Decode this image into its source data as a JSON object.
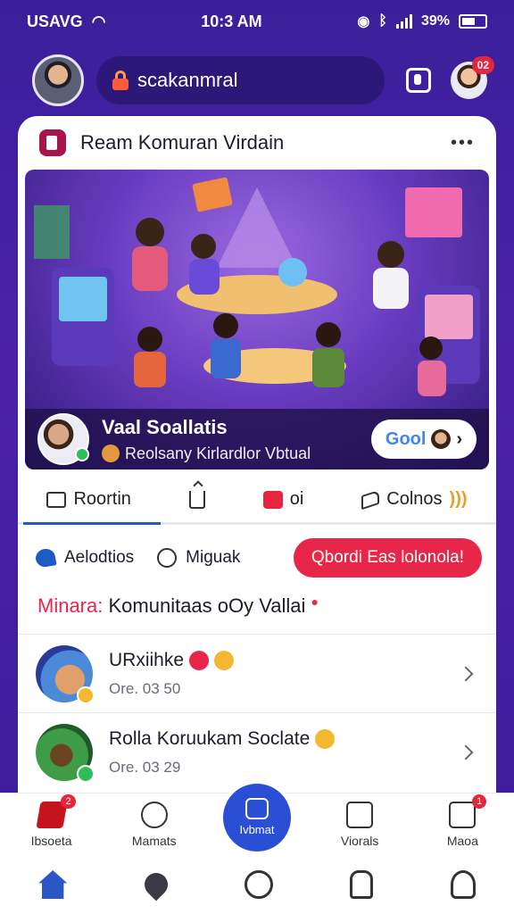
{
  "status": {
    "carrier": "USAVG",
    "time": "10:3 AM",
    "battery": "39%"
  },
  "top": {
    "search_text": "scakanmral",
    "notify_count": "02"
  },
  "card": {
    "title": "Ream Komuran Virdain"
  },
  "hero": {
    "name": "Vaal Soallatis",
    "subtitle": "Reolsany Kirlardlor Vbtual",
    "google_label": "Gool"
  },
  "actions": [
    {
      "label": "Roortin"
    },
    {
      "label": ""
    },
    {
      "label": "oi"
    },
    {
      "label": "Colnos"
    }
  ],
  "chips": [
    {
      "label": "Aelodtios"
    },
    {
      "label": "Miguak"
    },
    {
      "label": "Qbordi Eas lolonola!"
    }
  ],
  "section": {
    "accent": "Minara:",
    "title": "Komunitaas oOy Vallai"
  },
  "list": [
    {
      "name": "URxiihke",
      "meta": "Ore. 03 50"
    },
    {
      "name": "Rolla Koruukam Soclate",
      "meta": "Ore. 03 29"
    }
  ],
  "tabs": [
    {
      "label": "Ibsoeta",
      "badge": "2"
    },
    {
      "label": "Mamats"
    },
    {
      "label": "Ivbmat"
    },
    {
      "label": "Viorals"
    },
    {
      "label": "Maoa",
      "badge": "1"
    }
  ],
  "colors": {
    "accent_red": "#e8264a",
    "brand_blue": "#2a4fd4",
    "background_purple": "#3a1f9a"
  }
}
